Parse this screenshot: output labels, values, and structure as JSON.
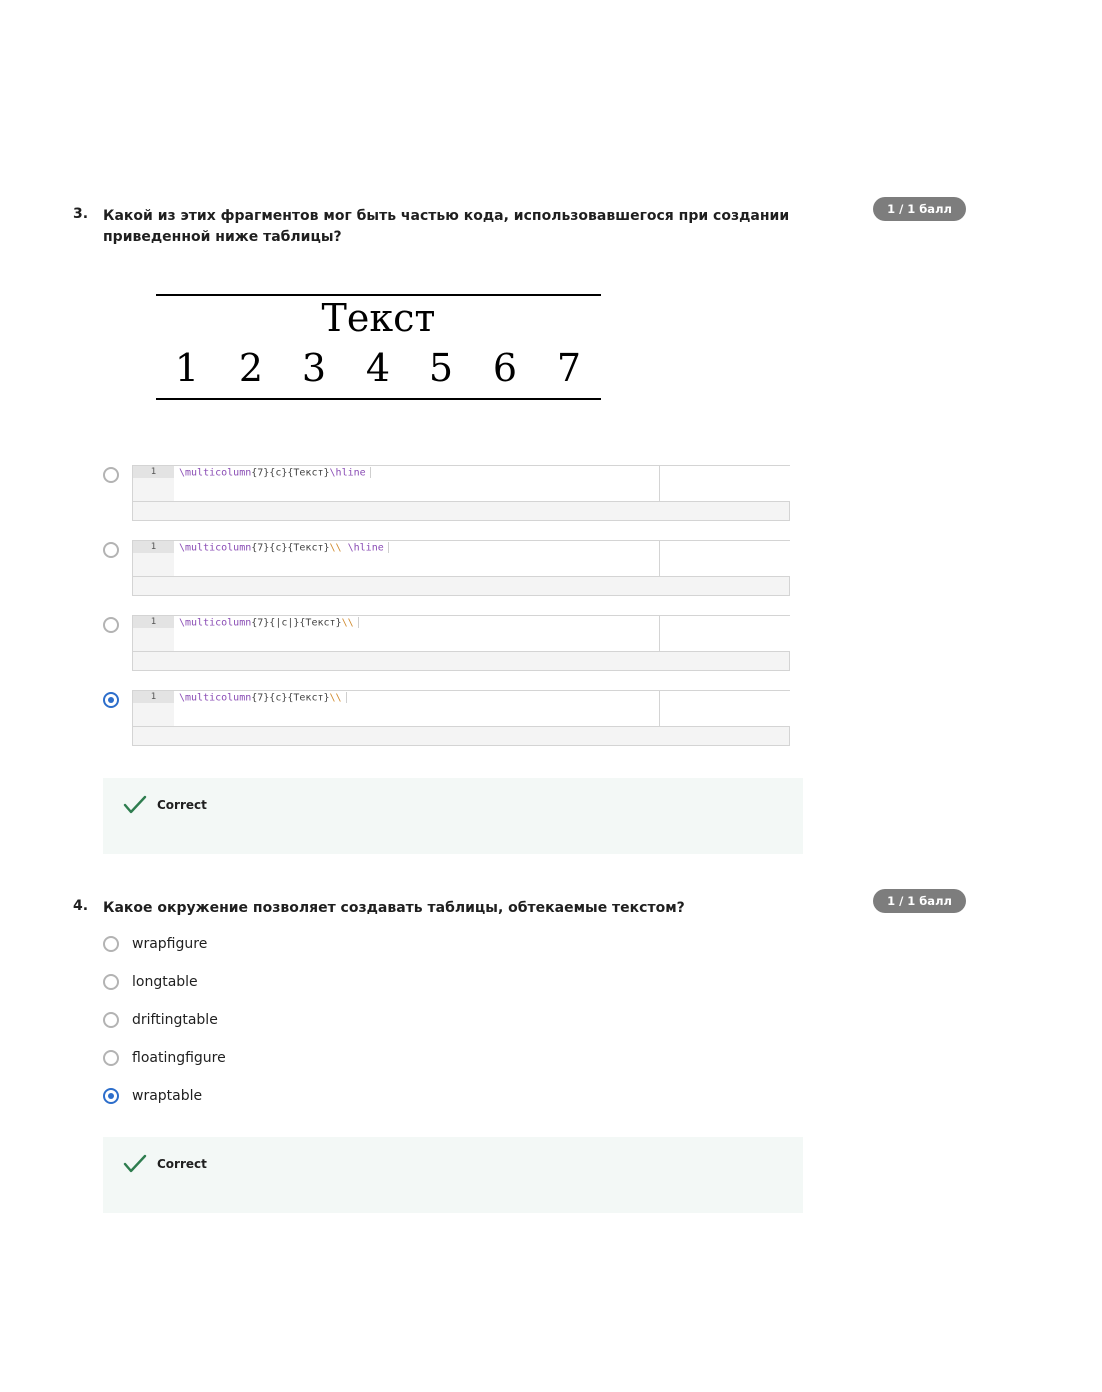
{
  "question3": {
    "number": "3.",
    "text": "Какой из этих фрагментов мог быть частью кода, использовавшегося при создании приведенной ниже таблицы?",
    "badge": "1 / 1 балл",
    "table_image": {
      "header": "Текст",
      "cells": [
        "1",
        "2",
        "3",
        "4",
        "5",
        "6",
        "7"
      ]
    },
    "options": [
      {
        "line_number": "1",
        "selected": false,
        "parts": [
          {
            "t": "\\multicolumn",
            "c": "kw"
          },
          {
            "t": "{7}{c}{Текст}",
            "c": ""
          },
          {
            "t": "\\hline",
            "c": "kw"
          }
        ]
      },
      {
        "line_number": "1",
        "selected": false,
        "parts": [
          {
            "t": "\\multicolumn",
            "c": "kw"
          },
          {
            "t": "{7}{c}{Текст}",
            "c": ""
          },
          {
            "t": "\\\\",
            "c": "ds"
          },
          {
            "t": " ",
            "c": ""
          },
          {
            "t": "\\hline",
            "c": "kw"
          }
        ]
      },
      {
        "line_number": "1",
        "selected": false,
        "parts": [
          {
            "t": "\\multicolumn",
            "c": "kw"
          },
          {
            "t": "{7}{|c|}{Текст}",
            "c": ""
          },
          {
            "t": "\\\\",
            "c": "ds"
          }
        ]
      },
      {
        "line_number": "1",
        "selected": true,
        "parts": [
          {
            "t": "\\multicolumn",
            "c": "kw"
          },
          {
            "t": "{7}{c}{Текст}",
            "c": ""
          },
          {
            "t": "\\\\",
            "c": "ds"
          }
        ]
      }
    ],
    "feedback": "Correct"
  },
  "question4": {
    "number": "4.",
    "text": "Какое окружение позволяет создавать таблицы, обтекаемые текстом?",
    "badge": "1 / 1 балл",
    "options": [
      {
        "label": "wrapfigure",
        "selected": false
      },
      {
        "label": "longtable",
        "selected": false
      },
      {
        "label": "driftingtable",
        "selected": false
      },
      {
        "label": "floatingfigure",
        "selected": false
      },
      {
        "label": "wraptable",
        "selected": true
      }
    ],
    "feedback": "Correct"
  },
  "colors": {
    "accent": "#2d6ecb",
    "badge": "#7d7d7d",
    "success": "#2e7d4f",
    "feedback_bg": "#f3f8f6"
  }
}
